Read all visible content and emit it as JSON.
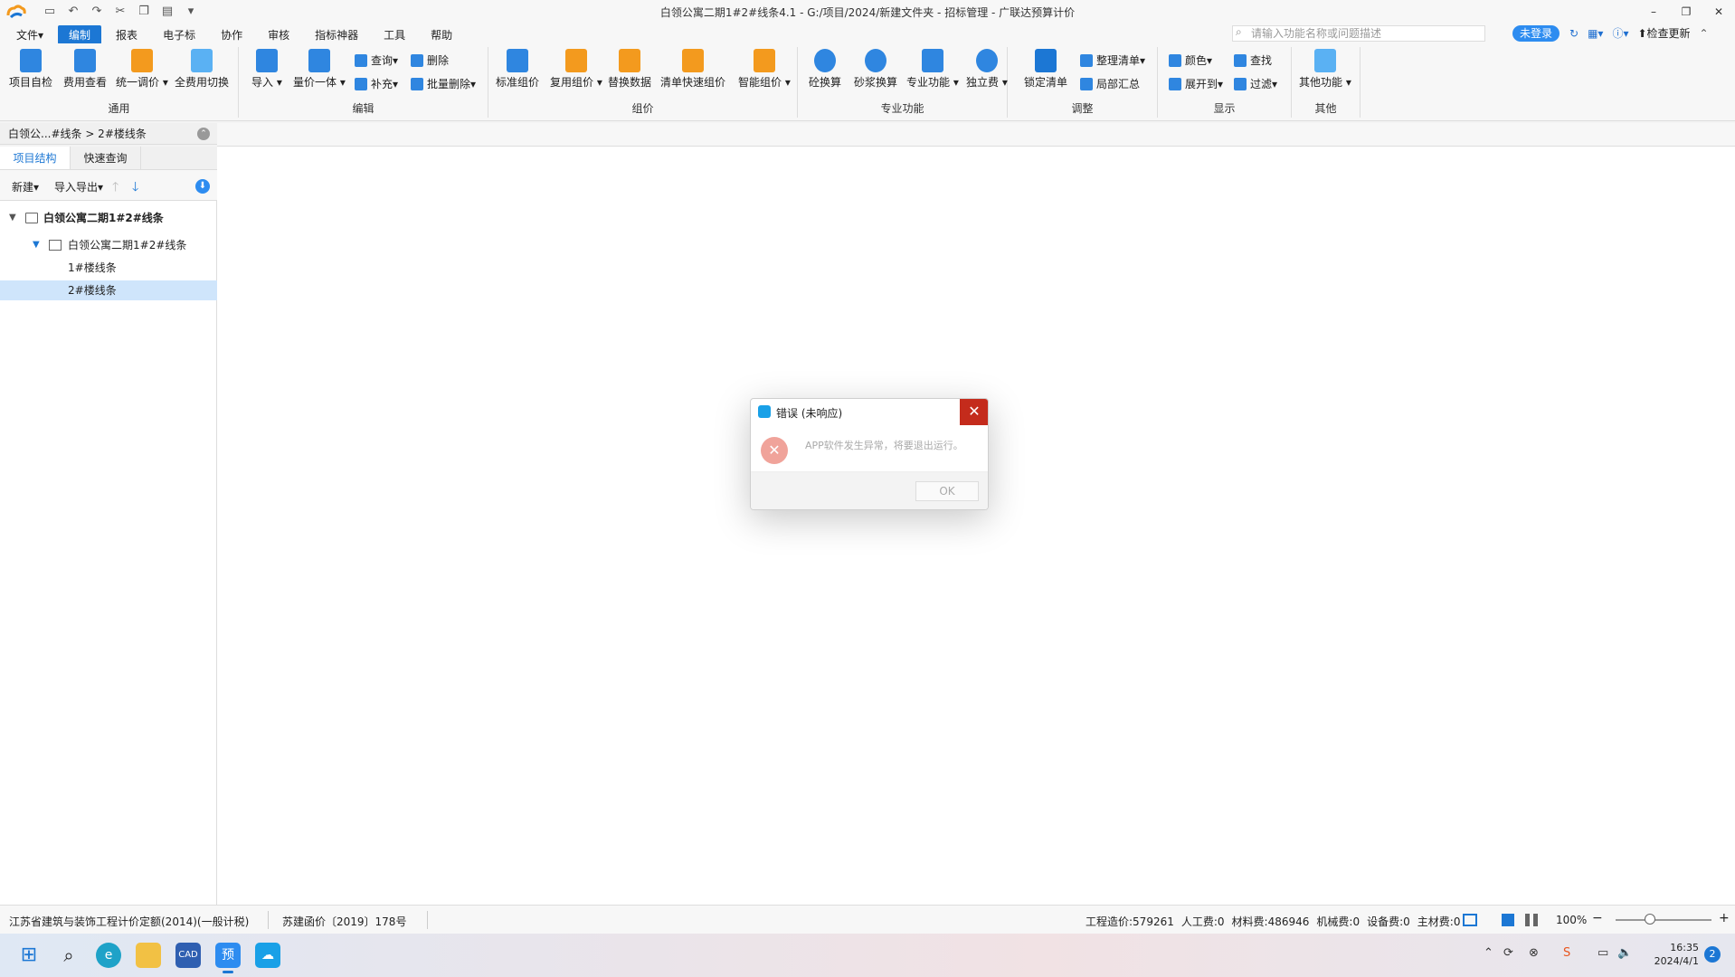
{
  "window": {
    "title": "白领公寓二期1#2#线条4.1 - G:/项目/2024/新建文件夹 - 招标管理 - 广联达预算计价",
    "minimize": "–",
    "restore": "❐",
    "close": "✕"
  },
  "menu": [
    "文件▾",
    "编制",
    "报表",
    "电子标",
    "协作",
    "审核",
    "指标神器",
    "工具",
    "帮助"
  ],
  "search": {
    "placeholder": "请输入功能名称或问题描述"
  },
  "login": "未登录",
  "check_update": "检查更新",
  "ribbon": {
    "groups": {
      "general": "通用",
      "edit": "编辑",
      "pricing": "组价",
      "special": "专业功能",
      "adjust": "调整",
      "display": "显示",
      "other": "其他"
    },
    "buttons": {
      "self_check": "项目自检",
      "fee_view": "费用查看",
      "unify_adjust": "统一调价",
      "full_fee_switch": "全费用切换",
      "import": "导入",
      "qty_price": "量价一体",
      "query": "查询",
      "supplement": "补充",
      "delete": "删除",
      "batch_delete": "批量删除",
      "std_pricing": "标准组价",
      "reuse_pricing": "复用组价",
      "replace_data": "替换数据",
      "list_quick_pricing": "清单快速组价",
      "smart_pricing": "智能组价",
      "concrete_calc": "砼换算",
      "mortar_calc": "砂浆换算",
      "special_func": "专业功能",
      "independent_fee": "独立费",
      "lock_list": "锁定清单",
      "organize_list": "整理清单",
      "partial_summary": "局部汇总",
      "color": "颜色",
      "expand_to": "展开到",
      "find": "查找",
      "filter": "过滤",
      "other_func": "其他功能"
    }
  },
  "breadcrumb": "白领公...#线条 > 2#楼线条",
  "left_tabs": [
    "项目结构",
    "快速查询"
  ],
  "left_toolbar": {
    "new": "新建▾",
    "import_export": "导入导出▾"
  },
  "tree": [
    {
      "label": "白领公寓二期1#2#线条",
      "level": 0
    },
    {
      "label": "白领公寓二期1#2#线条",
      "level": 1
    },
    {
      "label": "1#楼线条",
      "level": 2
    },
    {
      "label": "2#楼线条",
      "level": 2,
      "selected": true
    }
  ],
  "dialog": {
    "title": "错误 (未响应)",
    "message": "APP软件发生异常，将要退出运行。",
    "ok": "OK"
  },
  "status": {
    "quota": "江苏省建筑与装饰工程计价定额(2014)(一般计税)",
    "doc": "苏建函价〔2019〕178号",
    "project_cost": "工程造价:579261",
    "labor": "人工费:0",
    "material": "材料费:486946",
    "machine": "机械费:0",
    "equipment": "设备费:0",
    "main_material": "主材费:0",
    "zoom": "100%",
    "zoom_level": 0.3
  },
  "taskbar": {
    "time": "16:35",
    "date": "2024/4/1",
    "notifications": "2"
  },
  "colors": {
    "accent": "#1c77d4",
    "close_red": "#c42b1c",
    "selection": "#cfe5fb"
  }
}
